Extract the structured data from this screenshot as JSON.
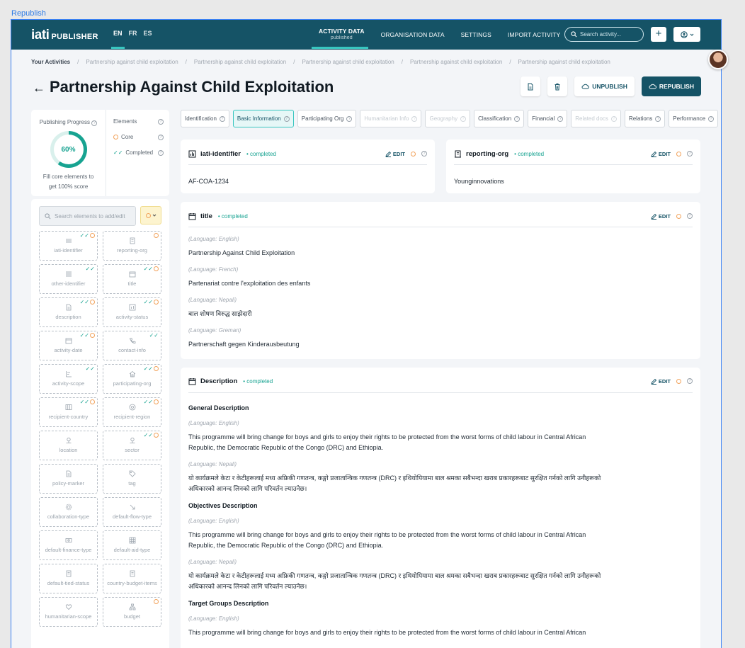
{
  "frame_label": "Republish",
  "header": {
    "logo_iati": "iati",
    "logo_publisher": "PUBLISHER",
    "languages": [
      "EN",
      "FR",
      "ES"
    ],
    "nav": [
      {
        "label": "ACTIVITY DATA",
        "sub": "published"
      },
      {
        "label": "ORGANISATION DATA"
      },
      {
        "label": "SETTINGS"
      },
      {
        "label": "IMPORT ACTIVITY"
      }
    ],
    "search_placeholder": "Search activity...",
    "add_label": "+"
  },
  "breadcrumb": [
    "Your Activities",
    "Partnership against child exploitation",
    "Partnership against child exploitation",
    "Partnership against child exploitation",
    "Partnership against child exploitation",
    "Partnership against child exploitation"
  ],
  "breadcrumb_sep": "/",
  "page_title": "Partnership Against Child Exploitation",
  "actions": {
    "unpublish": "UNPUBLISH",
    "republish": "REPUBLISH"
  },
  "progress": {
    "title": "Publishing Progress",
    "percent_label": "60%",
    "percent_value": 60,
    "note_line1": "Fill core elements to",
    "note_line2": "get 100% score",
    "elements_title": "Elements",
    "core_label": "Core",
    "completed_label": "Completed"
  },
  "elements_panel": {
    "search_placeholder": "Search elements to add/edit",
    "items": [
      {
        "label": "iati-identifier",
        "icon": "bars-icon",
        "completed": true,
        "core": true
      },
      {
        "label": "reporting-org",
        "icon": "building-icon",
        "completed": false,
        "core": true
      },
      {
        "label": "other-identifier",
        "icon": "list-icon",
        "completed": true,
        "core": false
      },
      {
        "label": "title",
        "icon": "calendar-icon",
        "completed": true,
        "core": true
      },
      {
        "label": "description",
        "icon": "document-icon",
        "completed": true,
        "core": true
      },
      {
        "label": "activity-status",
        "icon": "chart-icon",
        "completed": true,
        "core": true
      },
      {
        "label": "activity-date",
        "icon": "calendar-icon",
        "completed": true,
        "core": true
      },
      {
        "label": "contact-info",
        "icon": "phone-icon",
        "completed": true,
        "core": false
      },
      {
        "label": "activity-scope",
        "icon": "scope-icon",
        "completed": true,
        "core": false
      },
      {
        "label": "participating-org",
        "icon": "home-icon",
        "completed": true,
        "core": true
      },
      {
        "label": "recipient-country",
        "icon": "map-icon",
        "completed": true,
        "core": true
      },
      {
        "label": "recipient-region",
        "icon": "target-icon",
        "completed": true,
        "core": true
      },
      {
        "label": "location",
        "icon": "pin-icon",
        "completed": false,
        "core": false
      },
      {
        "label": "sector",
        "icon": "pin-icon",
        "completed": true,
        "core": true
      },
      {
        "label": "policy-marker",
        "icon": "document-icon",
        "completed": false,
        "core": false
      },
      {
        "label": "tag",
        "icon": "tag-icon",
        "completed": false,
        "core": false
      },
      {
        "label": "collaboration-type",
        "icon": "gear-icon",
        "completed": false,
        "core": false
      },
      {
        "label": "default-flow-type",
        "icon": "arrow-icon",
        "completed": false,
        "core": false
      },
      {
        "label": "default-finance-type",
        "icon": "money-icon",
        "completed": false,
        "core": false
      },
      {
        "label": "default-aid-type",
        "icon": "grid-icon",
        "completed": false,
        "core": false
      },
      {
        "label": "default-tied-status",
        "icon": "building-icon",
        "completed": false,
        "core": false
      },
      {
        "label": "country-budget-items",
        "icon": "building-icon",
        "completed": false,
        "core": false
      },
      {
        "label": "humanitarian-scope",
        "icon": "heart-icon",
        "completed": false,
        "core": false
      },
      {
        "label": "budget",
        "icon": "tree-icon",
        "completed": false,
        "core": true
      }
    ]
  },
  "tabs": [
    {
      "label": "Identification",
      "state": "normal"
    },
    {
      "label": "Basic Information",
      "state": "active"
    },
    {
      "label": "Participating Org",
      "state": "normal"
    },
    {
      "label": "Humanitarian Info",
      "state": "disabled"
    },
    {
      "label": "Geography",
      "state": "disabled"
    },
    {
      "label": "Classification",
      "state": "normal"
    },
    {
      "label": "Financial",
      "state": "normal"
    },
    {
      "label": "Related docs",
      "state": "disabled"
    },
    {
      "label": "Relations",
      "state": "normal"
    },
    {
      "label": "Performance",
      "state": "normal"
    }
  ],
  "edit_label": "EDIT",
  "completed_status": "completed",
  "cards": {
    "iati_identifier": {
      "title": "iati-identifier",
      "value": "AF-COA-1234"
    },
    "reporting_org": {
      "title": "reporting-org",
      "value": "Younginnovations"
    },
    "title": {
      "title": "title",
      "entries": [
        {
          "lang": "(Language: English)",
          "text": "Partnership Against Child Exploitation"
        },
        {
          "lang": "(Language: French)",
          "text": "Partenariat contre l'exploitation des enfants"
        },
        {
          "lang": "(Language: Nepali)",
          "text": "बाल शोषण विरुद्ध साझेदारी"
        },
        {
          "lang": "(Language: Greman)",
          "text": "Partnerschaft gegen Kinderausbeutung"
        }
      ]
    },
    "description": {
      "title": "Description",
      "sections": [
        {
          "heading": "General Description",
          "entries": [
            {
              "lang": "(Language: English)",
              "text": "This programme will bring change for boys and girls to enjoy their rights to be protected from the worst forms of child labour in Central African Republic, the Democratic Republic of the Congo (DRC) and Ethiopia."
            },
            {
              "lang": "(Language: Nepali)",
              "text": "यो कार्यक्रमले केटा र केटीहरूलाई मध्य अफ्रिकी गणतन्त्र, कङ्गो प्रजातान्त्रिक गणतन्त्र (DRC) र इथियोपियामा बाल श्रमका सबैभन्दा खराब प्रकारहरूबाट सुरक्षित गर्नको लागि उनीहरूको अधिकारको आनन्द लिनको लागि परिवर्तन ल्याउनेछ।"
            }
          ]
        },
        {
          "heading": "Objectives Description",
          "entries": [
            {
              "lang": "(Language: English)",
              "text": "This programme will bring change for boys and girls to enjoy their rights to be protected from the worst forms of child labour in Central African Republic, the Democratic Republic of the Congo (DRC) and Ethiopia."
            },
            {
              "lang": "(Language: Nepali)",
              "text": "यो कार्यक्रमले केटा र केटीहरूलाई मध्य अफ्रिकी गणतन्त्र, कङ्गो प्रजातान्त्रिक गणतन्त्र (DRC) र इथियोपियामा बाल श्रमका सबैभन्दा खराब प्रकारहरूबाट सुरक्षित गर्नको लागि उनीहरूको अधिकारको आनन्द लिनको लागि परिवर्तन ल्याउनेछ।"
            }
          ]
        },
        {
          "heading": "Target Groups Description",
          "entries": [
            {
              "lang": "(Language: English)",
              "text": "This programme will bring change for boys and girls to enjoy their rights to be protected from the worst forms of child labour in Central African"
            }
          ]
        }
      ]
    }
  },
  "colors": {
    "brand": "#155366",
    "accent": "#38c6c0",
    "completed": "#17a391",
    "core": "#f2a35c"
  }
}
